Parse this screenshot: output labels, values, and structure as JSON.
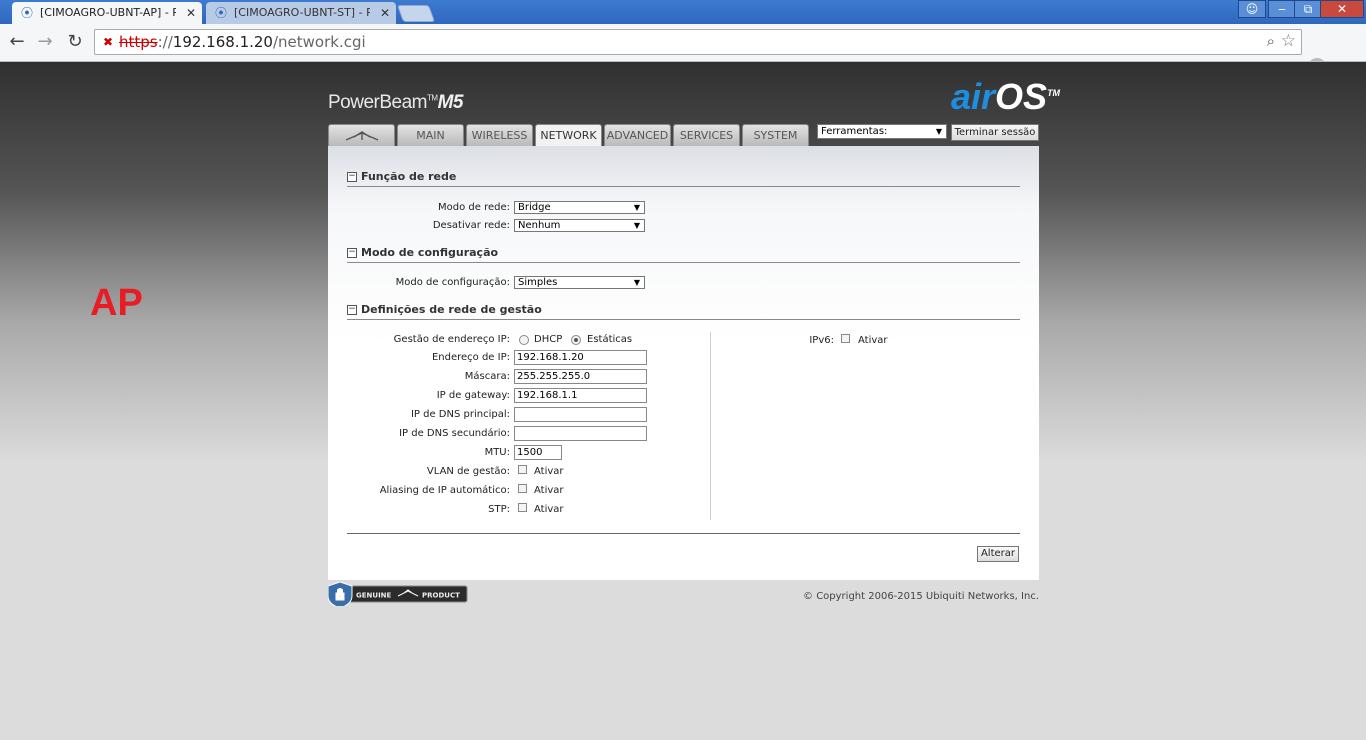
{
  "browser": {
    "tabs": [
      {
        "title": "[CIMOAGRO-UBNT-AP] - Red",
        "active": true
      },
      {
        "title": "[CIMOAGRO-UBNT-ST] - Prin",
        "active": false
      }
    ],
    "url_scheme": "https",
    "url_sep": "://",
    "url_host": "192.168.1.20",
    "url_path": "/network.cgi"
  },
  "annotation": {
    "text": "AP",
    "color": "#e81c24"
  },
  "header": {
    "brand": "PowerBeam",
    "brand_tm": "TM",
    "brand_model": "M5",
    "logo_air": "air",
    "logo_os": "OS",
    "logo_tm": "TM"
  },
  "nav": {
    "tabs": [
      "MAIN",
      "WIRELESS",
      "NETWORK",
      "ADVANCED",
      "SERVICES",
      "SYSTEM"
    ],
    "active": "NETWORK",
    "tools_label": "Ferramentas:",
    "logout_label": "Terminar sessão"
  },
  "sections": {
    "network_role": {
      "title": "Função de rede",
      "mode_label": "Modo de rede:",
      "mode_value": "Bridge",
      "disable_label": "Desativar rede:",
      "disable_value": "Nenhum"
    },
    "config_mode": {
      "title": "Modo de configuração",
      "label": "Modo de configuração:",
      "value": "Simples"
    },
    "management": {
      "title": "Definições de rede de gestão",
      "ip_mgmt_label": "Gestão de endereço IP:",
      "dhcp_label": "DHCP",
      "static_label": "Estáticas",
      "ip_label": "Endereço de IP:",
      "ip_value": "192.168.1.20",
      "mask_label": "Máscara:",
      "mask_value": "255.255.255.0",
      "gw_label": "IP de gateway:",
      "gw_value": "192.168.1.1",
      "dns1_label": "IP de DNS principal:",
      "dns1_value": "",
      "dns2_label": "IP de DNS secundário:",
      "dns2_value": "",
      "mtu_label": "MTU:",
      "mtu_value": "1500",
      "vlan_label": "VLAN de gestão:",
      "alias_label": "Aliasing de IP automático:",
      "stp_label": "STP:",
      "enable_label": "Ativar",
      "ipv6_label": "IPv6:",
      "ipv6_enable": "Ativar"
    }
  },
  "apply_label": "Alterar",
  "footer": {
    "genuine_left": "GENUINE",
    "genuine_right": "PRODUCT",
    "copyright": "© Copyright 2006-2015 Ubiquiti Networks, Inc."
  }
}
